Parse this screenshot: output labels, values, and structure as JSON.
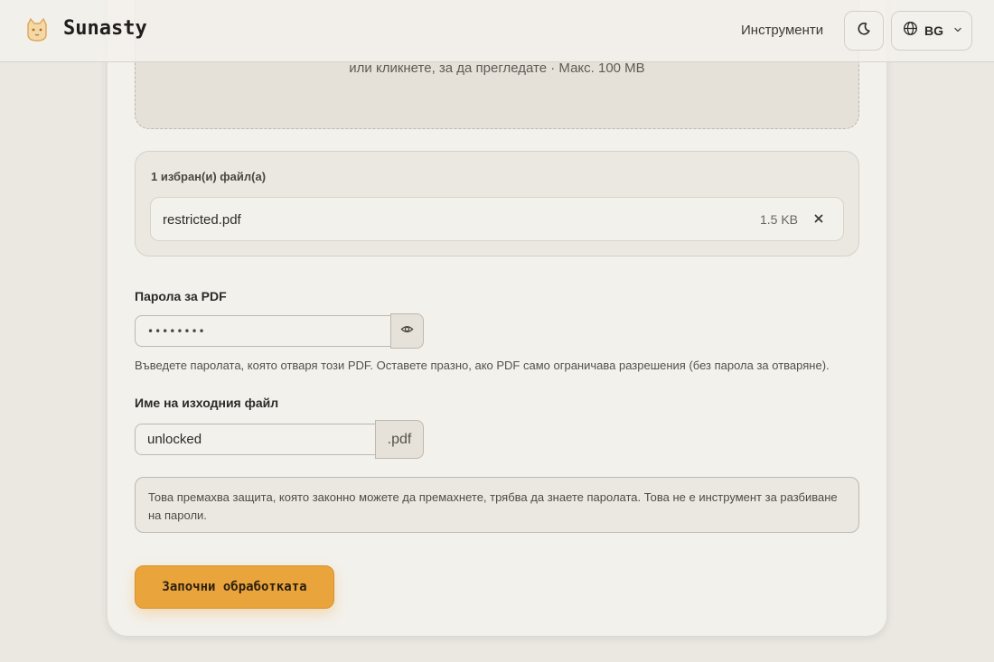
{
  "header": {
    "brand": "Sunasty",
    "nav_tools": "Инструменти",
    "language": "BG"
  },
  "dropzone": {
    "hint": "или кликнете, за да прегледате · Макс. 100 MB"
  },
  "files": {
    "count_label": "1 избран(и) файл(а)",
    "items": [
      {
        "name": "restricted.pdf",
        "size": "1.5 KB"
      }
    ]
  },
  "password": {
    "label": "Парола за PDF",
    "value": "••••••••",
    "help": "Въведете паролата, която отваря този PDF. Оставете празно, ако PDF само ограничава разрешения (без парола за отваряне)."
  },
  "output": {
    "label": "Име на изходния файл",
    "value": "unlocked",
    "suffix": ".pdf"
  },
  "notice": "Това премахва защита, която законно можете да премахнете, трябва да знаете паролата. Това не е инструмент за разбиване на пароли.",
  "start_label": "Започни обработката",
  "colors": {
    "accent": "#eaa43c",
    "background": "#ebe8e2",
    "card": "#f3f1ec"
  }
}
